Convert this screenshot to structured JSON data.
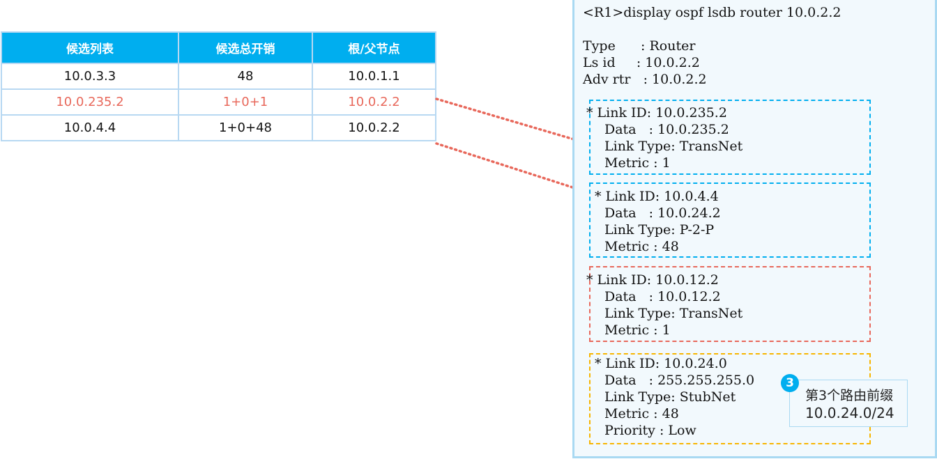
{
  "table": {
    "headers": [
      "候选列表",
      "候选总开销",
      "根/父节点"
    ],
    "rows": [
      {
        "candidate": "10.0.3.3",
        "cost": "48",
        "parent": "10.0.1.1",
        "highlight": false
      },
      {
        "candidate": "10.0.235.2",
        "cost": "1+0+1",
        "parent": "10.0.2.2",
        "highlight": true
      },
      {
        "candidate": "10.0.4.4",
        "cost": "1+0+48",
        "parent": "10.0.2.2",
        "highlight": false
      }
    ]
  },
  "lsdb": {
    "command": "<R1>display ospf lsdb router 10.0.2.2",
    "type": "Type      : Router",
    "ls_id": "Ls id     : 10.0.2.2",
    "adv_rtr": "Adv rtr   : 10.0.2.2",
    "links": [
      {
        "color": "#00aeef",
        "id": "* Link ID: 10.0.235.2",
        "data": "Data   : 10.0.235.2",
        "type": "Link Type: TransNet",
        "metric": "Metric : 1"
      },
      {
        "color": "#00aeef",
        "id": "* Link ID: 10.0.4.4",
        "data": "Data   : 10.0.24.2",
        "type": "Link Type: P-2-P",
        "metric": "Metric : 48"
      },
      {
        "color": "#e8685b",
        "id": "* Link ID: 10.0.12.2",
        "data": "Data   : 10.0.12.2",
        "type": "Link Type: TransNet",
        "metric": "Metric : 1"
      },
      {
        "color": "#f7b500",
        "id": "* Link ID: 10.0.24.0",
        "data": "Data   : 255.255.255.0",
        "type": "Link Type: StubNet",
        "metric": "Metric : 48",
        "priority": "Priority : Low"
      }
    ]
  },
  "callout": {
    "step": "3",
    "title": "第3个路由前缀",
    "value": "10.0.24.0/24"
  },
  "colors": {
    "header_bg": "#00aeef",
    "highlight": "#e8685b",
    "connector": "#e8685b",
    "panel_border": "#a9d9f2"
  }
}
